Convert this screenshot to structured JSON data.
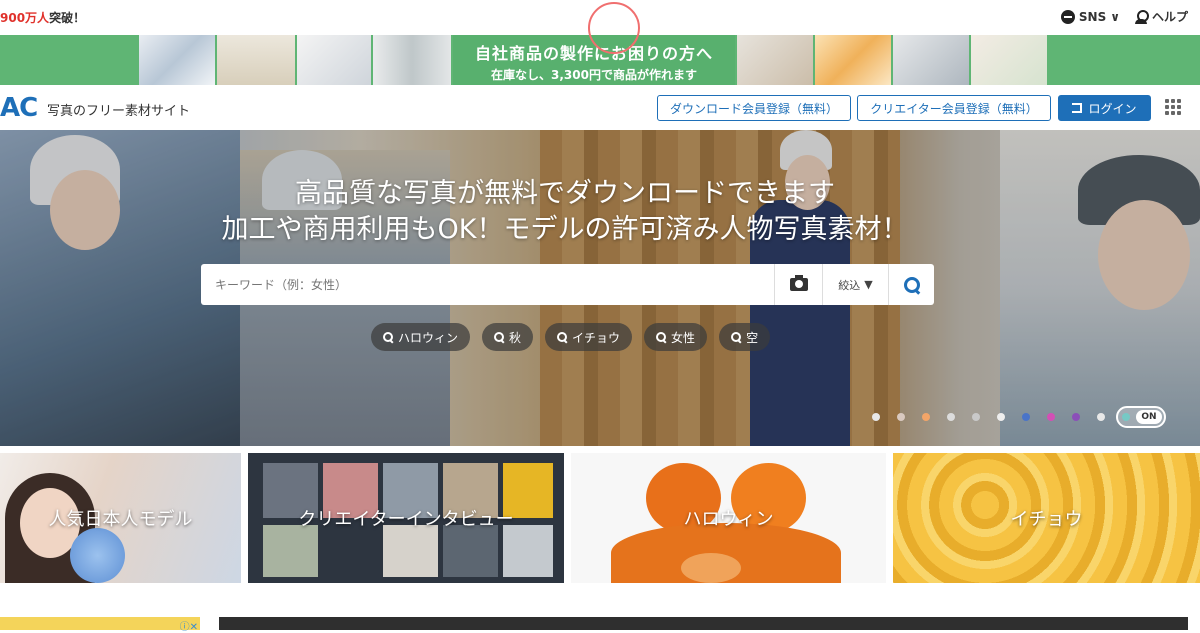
{
  "topbar": {
    "announce_num": "900万人",
    "announce_suffix": "突破！",
    "sns_label": "SNS",
    "sns_chevron": "∨",
    "help_label": "ヘルプ"
  },
  "ad": {
    "line1": "自社商品の製作にお困りの方へ",
    "line2": "在庫なし、3,300円で商品が作れます"
  },
  "header": {
    "logo": "AC",
    "tagline": "写真のフリー素材サイト",
    "download_register": "ダウンロード会員登録（無料）",
    "creator_register": "クリエイター会員登録（無料）",
    "login": "ログイン"
  },
  "hero": {
    "headline1": "高品質な写真が無料でダウンロードできます",
    "headline2": "加工や商用利用もOK！モデルの許可済み人物写真素材！",
    "search_placeholder": "キーワード（例：女性）",
    "filter_label": "絞込",
    "filter_caret": "▼",
    "tags": [
      "ハロウィン",
      "秋",
      "イチョウ",
      "女性",
      "空"
    ],
    "toggle_label": "ON",
    "dot_colors": [
      "#e8e8e8",
      "#d9c9c0",
      "#f3a568",
      "#dcdcdc",
      "#c9c9c9",
      "#eeeeee",
      "#4a74c8",
      "#d34fb5",
      "#8b4fb8",
      "#e8e8e8",
      "#49b7b2"
    ]
  },
  "categories": [
    {
      "label": "人気日本人モデル"
    },
    {
      "label": "クリエイターインタビュー"
    },
    {
      "label": "ハロウィン"
    },
    {
      "label": "イチョウ"
    }
  ],
  "bottom_ad": {
    "close": "ⓘ✕"
  }
}
